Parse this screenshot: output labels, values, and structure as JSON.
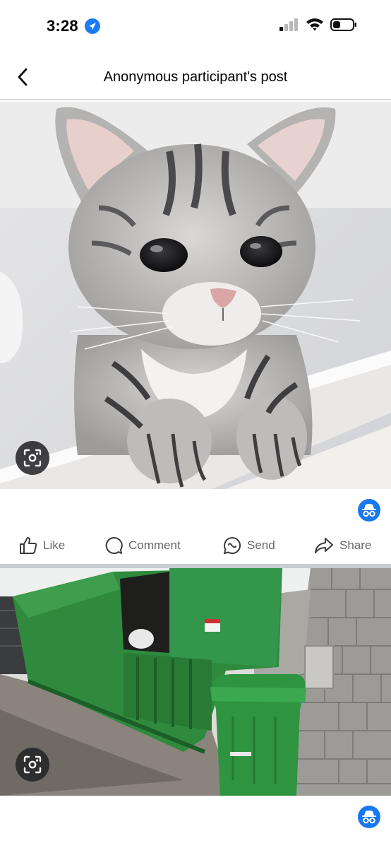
{
  "status_bar": {
    "time": "3:28",
    "location_icon": "location-arrow-icon",
    "signal_icon": "cellular-signal-icon",
    "wifi_icon": "wifi-icon",
    "battery_icon": "battery-low-icon"
  },
  "header": {
    "back_icon": "chevron-left-icon",
    "title": "Anonymous participant's post"
  },
  "posts": [
    {
      "image_subject": "sad-eyed tabby kitten",
      "visual_search_icon": "camera-lens-icon",
      "author_badge_icon": "incognito-icon",
      "actions": [
        {
          "label": "Like",
          "icon": "thumbs-up-icon"
        },
        {
          "label": "Comment",
          "icon": "comment-bubble-icon"
        },
        {
          "label": "Send",
          "icon": "messenger-send-icon"
        },
        {
          "label": "Share",
          "icon": "share-arrow-icon"
        }
      ]
    },
    {
      "image_subject": "green dumpster compactor and wheelie bin",
      "visual_search_icon": "camera-lens-icon",
      "author_badge_icon": "incognito-icon"
    }
  ],
  "colors": {
    "accent": "#1877f2",
    "location": "#1a7cf5",
    "action_text": "#65676b",
    "divider": "#c9ccd1"
  }
}
